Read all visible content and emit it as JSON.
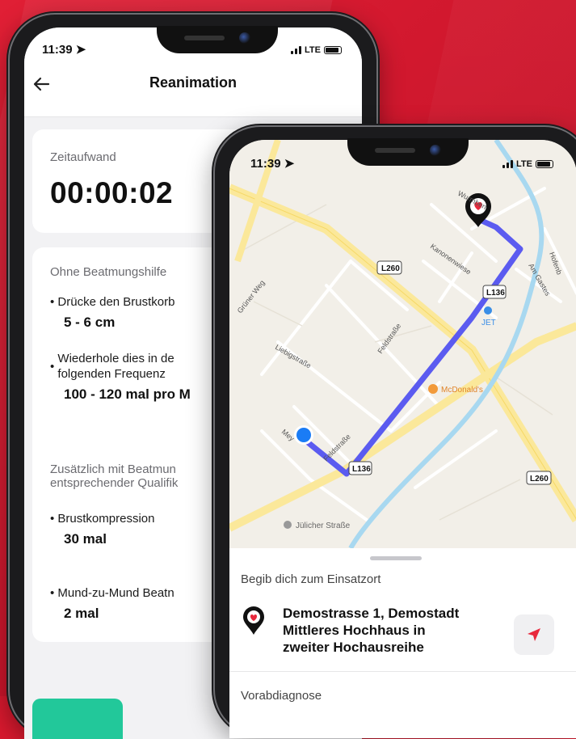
{
  "colors": {
    "background": "#d8192e",
    "accent_green": "#22c89a",
    "route": "#5b5bf0",
    "user_dot": "#1a7cf5",
    "nav_arrow": "#e8283c"
  },
  "left_phone": {
    "status_time": "11:39",
    "network": "LTE",
    "header": {
      "back_icon": "arrow-left-icon",
      "title": "Reanimation"
    },
    "time_card": {
      "label": "Zeitaufwand",
      "value": "00:00:02"
    },
    "instructions": {
      "section1_label": "Ohne Beatmungshilfe",
      "items": [
        {
          "text": "Drücke den Brustkorb",
          "value": "5 - 6 cm"
        },
        {
          "text_line1": "Wiederhole dies in de",
          "text_line2": "folgenden Frequenz",
          "value": "100 - 120 mal pro M"
        }
      ],
      "section2_line1": "Zusätzlich mit Beatmun",
      "section2_line2": "entsprechender Qualifik",
      "items2": [
        {
          "text": "Brustkompression",
          "value": "30 mal"
        },
        {
          "text": "Mund-zu-Mund Beatn",
          "value": "2 mal"
        }
      ]
    }
  },
  "right_phone": {
    "status_time": "11:39",
    "network": "LTE",
    "map": {
      "road_labels": [
        "L260",
        "L136",
        "L136",
        "L260"
      ],
      "street_labels": [
        "Grüner Weg",
        "Liebigstraße",
        "Feldstraße",
        "Feldstraße",
        "Kanonenwiese",
        "Wurmben",
        "Am Gastes",
        "Hofenb",
        "Mey"
      ],
      "poi": [
        {
          "name": "JET",
          "icon": "fuel-icon"
        },
        {
          "name": "McDonald's",
          "icon": "food-icon"
        },
        {
          "name": "Jülicher Straße",
          "icon": "pin-icon"
        }
      ],
      "destination_icon": "heart-pin-icon"
    },
    "sheet": {
      "heading": "Begib dich zum Einsatzort",
      "address_line1": "Demostrasse 1, Demostadt",
      "address_line2": "Mittleres Hochhaus in",
      "address_line3": "zweiter Hochausreihe",
      "nav_icon": "navigation-arrow-icon",
      "next_label": "Vorabdiagnose"
    }
  }
}
